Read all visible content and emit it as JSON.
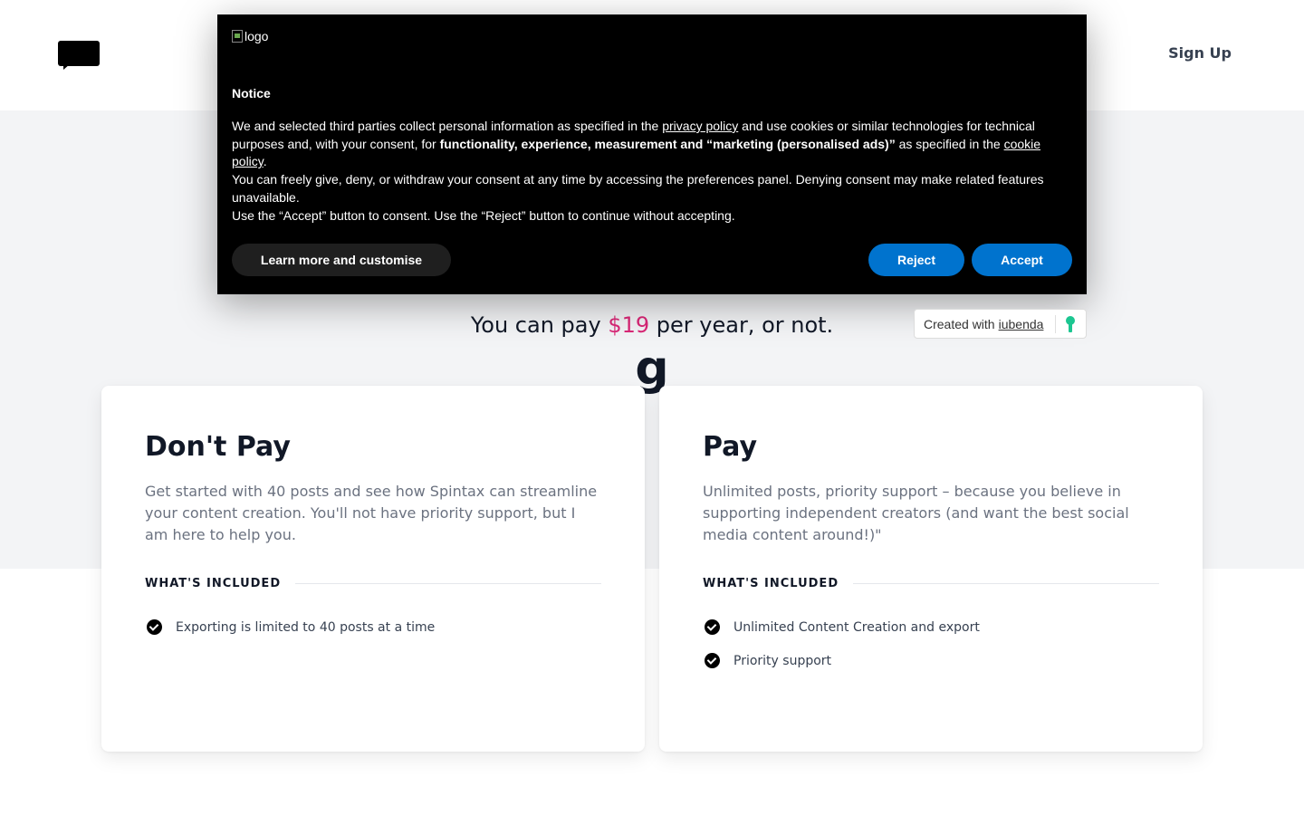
{
  "header": {
    "signup_label": "Sign Up"
  },
  "hero": {
    "title_partial": "g",
    "subtitle_pre": "You can pay ",
    "subtitle_price": "$19",
    "subtitle_post": " per year, or not."
  },
  "plans": [
    {
      "title": "Don't Pay",
      "description": "Get started with 40 posts and see how Spintax can streamline your content creation. You'll not have priority support, but I am here to help you.",
      "included_label": "WHAT'S INCLUDED",
      "features": [
        "Exporting is limited to 40 posts at a time"
      ]
    },
    {
      "title": "Pay",
      "description": "Unlimited posts, priority support – because you believe in supporting independent creators (and want the best social media content around!)\"",
      "included_label": "WHAT'S INCLUDED",
      "features": [
        "Unlimited Content Creation and export",
        "Priority support"
      ]
    }
  ],
  "cookie": {
    "logo_alt": "logo",
    "notice_title": "Notice",
    "p1_a": "We and selected third parties collect personal information as specified in the ",
    "privacy_link": "privacy policy",
    "p1_b": " and use cookies or similar technologies for technical purposes and, with your consent, for ",
    "p1_bold": "functionality, experience, measurement and “marketing (personalised ads)”",
    "p1_c": " as specified in the ",
    "cookie_link": "cookie policy",
    "p1_d": ".",
    "p2": "You can freely give, deny, or withdraw your consent at any time by accessing the preferences panel. Denying consent may make related features unavailable.",
    "p3": "Use the “Accept” button to consent. Use the “Reject” button to continue without accepting.",
    "learn_label": "Learn more and customise",
    "reject_label": "Reject",
    "accept_label": "Accept"
  },
  "iubenda": {
    "prefix": "Created with",
    "link": "iubenda"
  },
  "colors": {
    "accent_price": "#db2777",
    "cookie_button": "#0073ce",
    "iubenda_green": "#1cc691"
  }
}
